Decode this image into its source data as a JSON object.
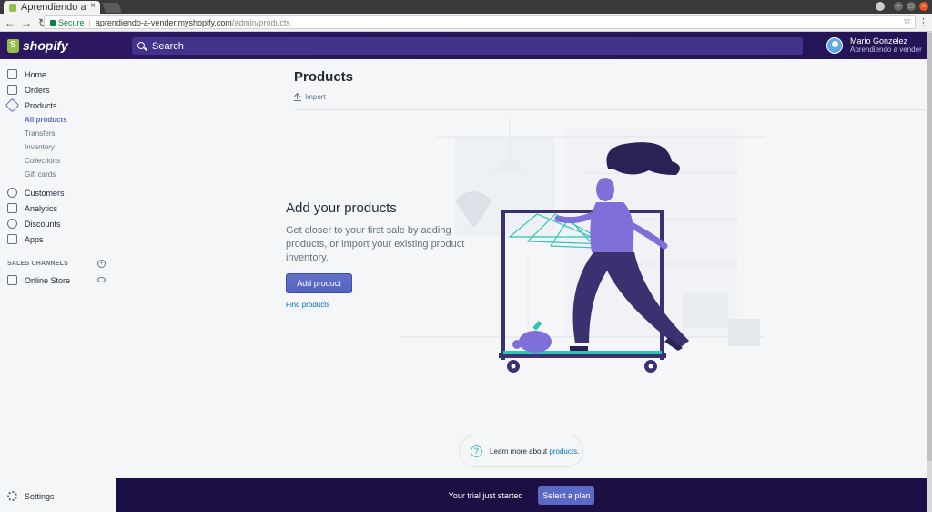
{
  "browser": {
    "tab_title": "Aprendiendo a",
    "tab_close": "×",
    "secure_label": "Secure",
    "url_host": "aprendiendo-a-vender.myshopify.com",
    "url_path": "/admin/products"
  },
  "topbar": {
    "logo_text": "shopify",
    "search_placeholder": "Search",
    "user_name": "Mario Gonzelez",
    "user_store": "Aprendiendo a vender"
  },
  "sidebar": {
    "items": [
      {
        "label": "Home",
        "icon": "home-icon"
      },
      {
        "label": "Orders",
        "icon": "orders-icon"
      },
      {
        "label": "Products",
        "icon": "tag-icon"
      },
      {
        "label": "Customers",
        "icon": "person-icon"
      },
      {
        "label": "Analytics",
        "icon": "bar-chart-icon"
      },
      {
        "label": "Discounts",
        "icon": "discount-icon"
      },
      {
        "label": "Apps",
        "icon": "apps-icon"
      }
    ],
    "product_subitems": [
      "All products",
      "Transfers",
      "Inventory",
      "Collections",
      "Gift cards"
    ],
    "sales_channels_label": "SALES CHANNELS",
    "online_store_label": "Online Store",
    "settings_label": "Settings"
  },
  "main": {
    "page_title": "Products",
    "import_label": "Import",
    "empty_title": "Add your products",
    "empty_description": "Get closer to your first sale by adding products, or import your existing product inventory.",
    "add_button": "Add product",
    "find_link": "Find products",
    "learn_more_prefix": "Learn more about",
    "learn_more_link": "products",
    "learn_more_suffix": "."
  },
  "trial": {
    "message": "Your trial just started",
    "button": "Select a plan"
  },
  "colors": {
    "brand_purple": "#5c6ac4",
    "topbar": "#2b1860",
    "trial_bar": "#1c0f43",
    "teal": "#47c1bf"
  }
}
